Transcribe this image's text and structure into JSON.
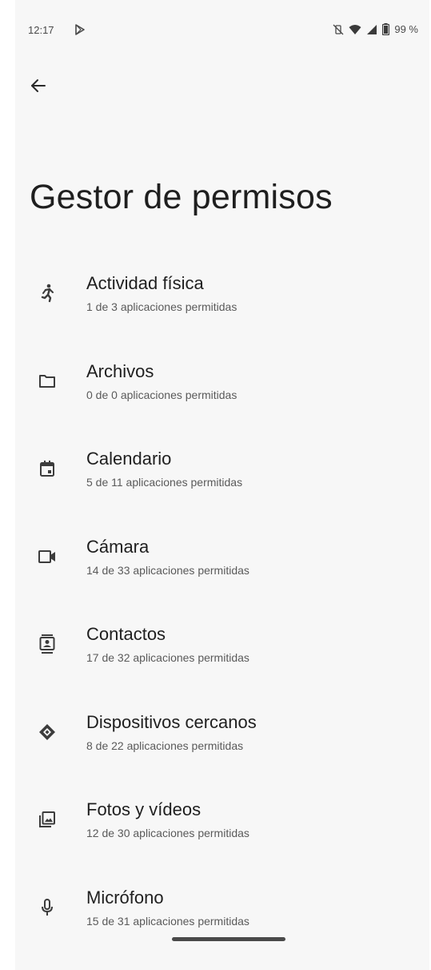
{
  "status_bar": {
    "time": "12:17",
    "battery": "99 %",
    "icons": [
      "play-store-icon",
      "vibrate-off-icon",
      "wifi-icon",
      "signal-icon",
      "battery-icon"
    ]
  },
  "header": {
    "back_icon": "arrow-back-icon",
    "title": "Gestor de permisos"
  },
  "permissions": [
    {
      "icon": "running-person-icon",
      "title": "Actividad física",
      "subtitle": "1 de 3 aplicaciones permitidas"
    },
    {
      "icon": "folder-icon",
      "title": "Archivos",
      "subtitle": "0 de 0 aplicaciones permitidas"
    },
    {
      "icon": "calendar-icon",
      "title": "Calendario",
      "subtitle": "5 de 11 aplicaciones permitidas"
    },
    {
      "icon": "video-camera-icon",
      "title": "Cámara",
      "subtitle": "14 de 33 aplicaciones permitidas"
    },
    {
      "icon": "contacts-icon",
      "title": "Contactos",
      "subtitle": "17 de 32 aplicaciones permitidas"
    },
    {
      "icon": "nearby-devices-icon",
      "title": "Dispositivos cercanos",
      "subtitle": "8 de 22 aplicaciones permitidas"
    },
    {
      "icon": "photos-icon",
      "title": "Fotos y vídeos",
      "subtitle": "12 de 30 aplicaciones permitidas"
    },
    {
      "icon": "microphone-icon",
      "title": "Micrófono",
      "subtitle": "15 de 31 aplicaciones permitidas"
    }
  ],
  "colors": {
    "background": "#f7f7f7",
    "text_primary": "#1f1f1f",
    "text_secondary": "#5a5a5a",
    "icon": "#3c3c3c"
  }
}
